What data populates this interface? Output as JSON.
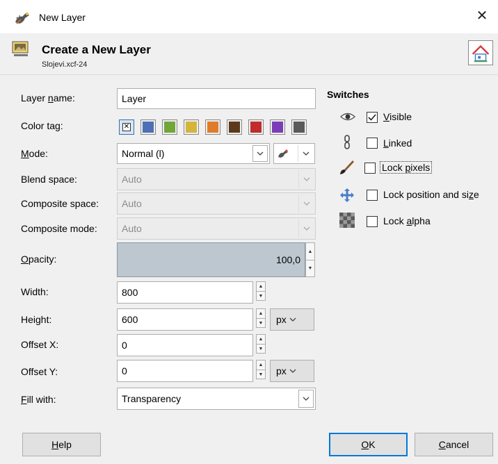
{
  "window": {
    "title": "New Layer"
  },
  "header": {
    "title": "Create a New Layer",
    "subtitle": "Slojevi.xcf-24"
  },
  "form": {
    "layer_name": {
      "label_pre": "Layer ",
      "label_u": "n",
      "label_post": "ame:",
      "value": "Layer"
    },
    "color_tag": {
      "label": "Color tag:",
      "colors": [
        "#4e6fb5",
        "#72a53a",
        "#d4b43a",
        "#e07b2a",
        "#5c3a1e",
        "#c12b2b",
        "#7a3db8",
        "#5a5a5a"
      ]
    },
    "mode": {
      "label_u": "M",
      "label_post": "ode:",
      "value": "Normal (l)"
    },
    "blend_space": {
      "label": "Blend space:",
      "value": "Auto"
    },
    "composite_space": {
      "label": "Composite space:",
      "value": "Auto"
    },
    "composite_mode": {
      "label": "Composite mode:",
      "value": "Auto"
    },
    "opacity": {
      "label_u": "O",
      "label_post": "pacity:",
      "value": "100,0"
    },
    "width": {
      "label": "Width:",
      "value": "800"
    },
    "height": {
      "label": "Height:",
      "value": "600",
      "unit": "px"
    },
    "offset_x": {
      "label": "Offset X:",
      "value": "0"
    },
    "offset_y": {
      "label": "Offset Y:",
      "value": "0",
      "unit": "px"
    },
    "fill_with": {
      "label_u": "F",
      "label_post": "ill with:",
      "value": "Transparency"
    }
  },
  "switches": {
    "title": "Switches",
    "items": [
      {
        "pre": "",
        "u": "V",
        "post": "isible",
        "checked": true,
        "icon": "eye-icon"
      },
      {
        "pre": "",
        "u": "L",
        "post": "inked",
        "checked": false,
        "icon": "chain-icon"
      },
      {
        "pre": "Lock ",
        "u": "p",
        "post": "ixels",
        "checked": false,
        "icon": "paintbrush-icon"
      },
      {
        "pre": "Lock position and si",
        "u": "z",
        "post": "e",
        "checked": false,
        "icon": "move-icon"
      },
      {
        "pre": "Lock ",
        "u": "a",
        "post": "lpha",
        "checked": false,
        "icon": "checker-icon"
      }
    ]
  },
  "buttons": {
    "help_u": "H",
    "help_post": "elp",
    "ok_u": "O",
    "ok_post": "K",
    "cancel_u": "C",
    "cancel_post": "ancel"
  }
}
